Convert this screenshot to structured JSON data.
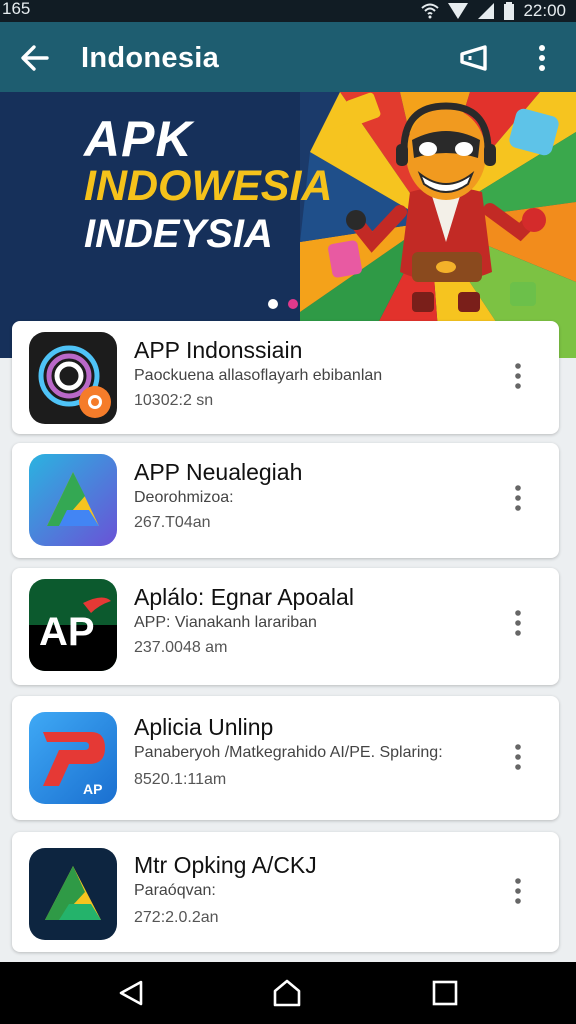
{
  "status_bar": {
    "left_text": "165",
    "time": "22:00"
  },
  "app_bar": {
    "title": "Indonesia"
  },
  "banner": {
    "line1": "APK",
    "line2": "INDOWESIA",
    "line3": "INDEYSIA",
    "page_count": 2,
    "active_page": 2
  },
  "apps": [
    {
      "name": "APP Indonssiain",
      "description": "Paockuena allasoflayarh ebibanlan",
      "meta": "10302:2 sn",
      "icon": "circle-swirl-icon"
    },
    {
      "name": "APP Neualegiah",
      "description": "Deorohmizoa:",
      "meta": "267.T04an",
      "icon": "triangle-play-icon"
    },
    {
      "name": "Aplálo: Egnar Apoalal",
      "description": "APP: Vianakanh larariban",
      "meta": "237.0048 am",
      "icon": "ap-logo-icon"
    },
    {
      "name": "Aplicia Unlinp",
      "description": "Panaberyoh /Matkegrahido AI/PE. Splaring:",
      "meta": "8520.1:11am",
      "icon": "p-logo-icon"
    },
    {
      "name": "Mtr Opking A/CKJ",
      "description": "Paraóqvan:",
      "meta": "272:2.0.2an",
      "icon": "triangle-play-dark-icon"
    }
  ],
  "colors": {
    "app_bar": "#1e5d70",
    "status_bar": "#111c24",
    "banner_navy": "#16305a",
    "banner_yellow": "#f5c21b",
    "page_bg": "#eceff1",
    "dot_active": "#e0398c"
  }
}
